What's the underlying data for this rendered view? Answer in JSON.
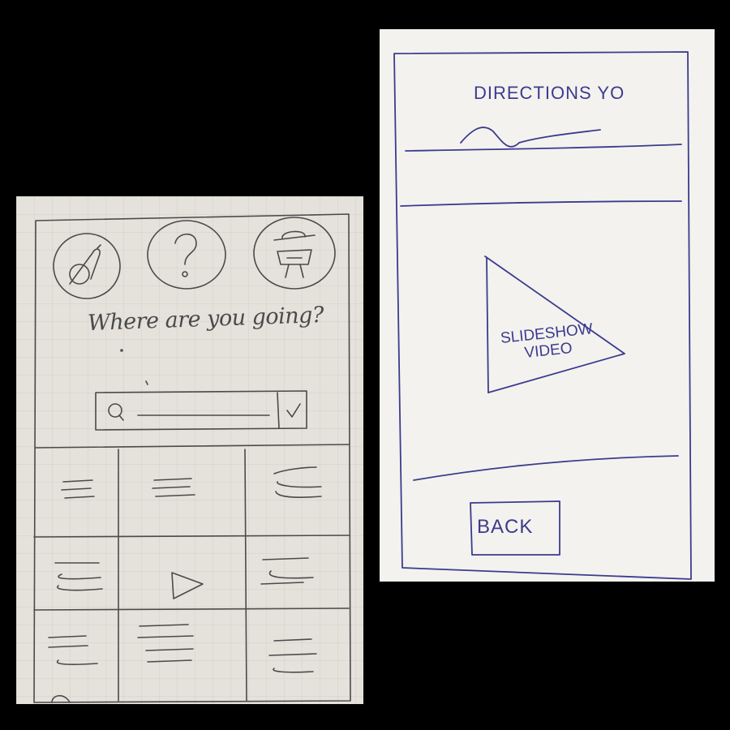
{
  "mobile_sketch": {
    "question": "Where are you going?",
    "icons": [
      "directions-icon",
      "help-icon",
      "water-fountain-icon",
      "search-icon",
      "checkmark-icon",
      "play-icon"
    ]
  },
  "detail_sketch": {
    "title": "DIRECTIONS YO",
    "video_label": "SLIDESHOW\nVIDEO",
    "back_label": "BACK"
  },
  "colors": {
    "pencil": "#4a4a4a",
    "ink": "#3b3b8f",
    "background": "#000000"
  }
}
